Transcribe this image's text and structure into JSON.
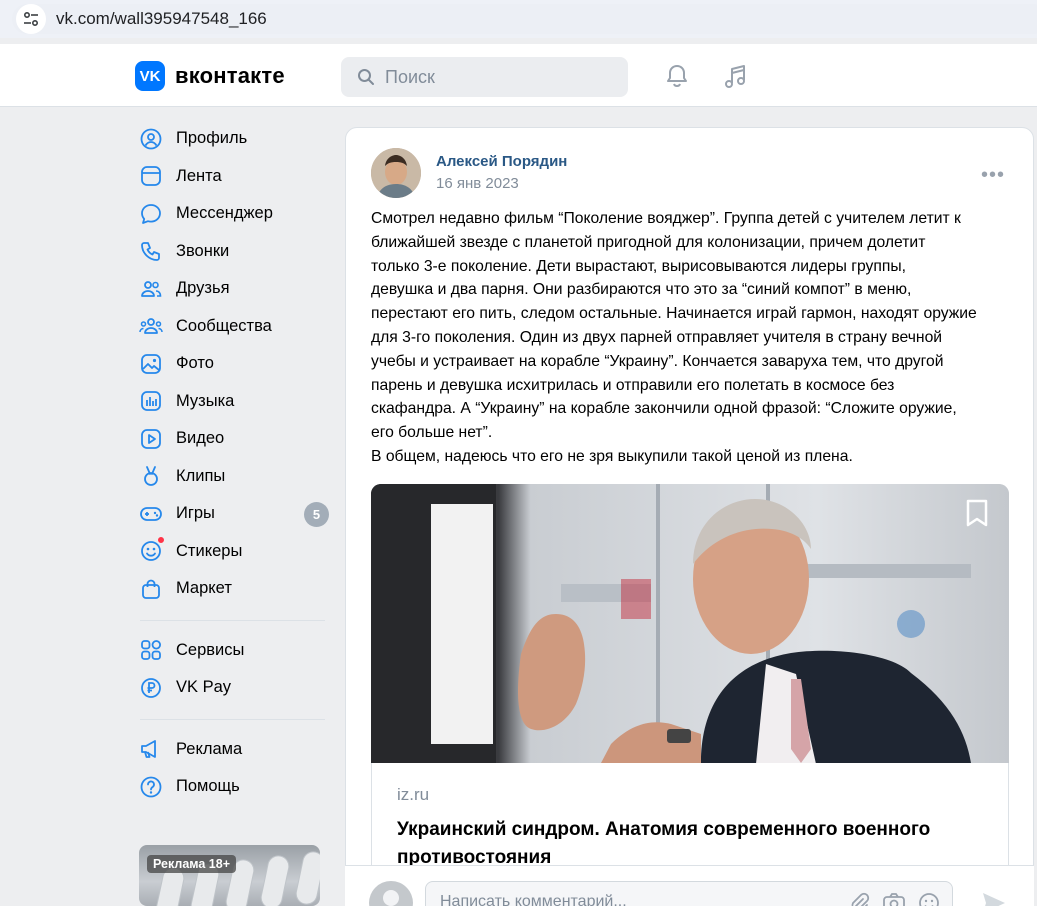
{
  "browser": {
    "url": "vk.com/wall395947548_166"
  },
  "header": {
    "logo_mark": "VK",
    "logo_text": "вконтакте",
    "search_placeholder": "Поиск"
  },
  "sidebar": {
    "items": [
      {
        "label": "Профиль",
        "icon": "profile-icon"
      },
      {
        "label": "Лента",
        "icon": "news-icon"
      },
      {
        "label": "Мессенджер",
        "icon": "messenger-icon"
      },
      {
        "label": "Звонки",
        "icon": "phone-icon"
      },
      {
        "label": "Друзья",
        "icon": "friends-icon"
      },
      {
        "label": "Сообщества",
        "icon": "communities-icon"
      },
      {
        "label": "Фото",
        "icon": "photo-icon"
      },
      {
        "label": "Музыка",
        "icon": "music-icon"
      },
      {
        "label": "Видео",
        "icon": "video-icon"
      },
      {
        "label": "Клипы",
        "icon": "clips-icon"
      },
      {
        "label": "Игры",
        "icon": "games-icon",
        "badge": "5"
      },
      {
        "label": "Стикеры",
        "icon": "stickers-icon"
      },
      {
        "label": "Маркет",
        "icon": "market-icon"
      }
    ],
    "group2": [
      {
        "label": "Сервисы",
        "icon": "services-icon"
      },
      {
        "label": "VK Pay",
        "icon": "vkpay-icon"
      }
    ],
    "group3": [
      {
        "label": "Реклама",
        "icon": "ads-icon"
      },
      {
        "label": "Помощь",
        "icon": "help-icon"
      }
    ],
    "ad_label": "Реклама 18+"
  },
  "post": {
    "author": "Алексей Порядин",
    "date": "16 янв 2023",
    "more": "•••",
    "text_lines": [
      "Смотрел недавно фильм “Поколение вояджер”. Группа детей с учителем летит к",
      "ближайшей звезде с планетой пригодной для колонизации, причем долетит",
      "только 3-е поколение. Дети вырастают, вырисовываются лидеры группы,",
      "девушка и два парня. Они разбираются что это за “синий компот” в меню,",
      "перестают его пить, следом остальные. Начинается играй гармон, находят оружие",
      "для 3-го поколения. Один из двух парней отправляет учителя в страну вечной",
      "учебы и устраивает на корабле “Украину”. Кончается заваруха тем, что другой",
      "парень и девушка исхитрилась и отправили его полетать в космосе без",
      "скафандра. А “Украину” на корабле закончили одной фразой: “Сложите оружие,",
      "его больше нет”.",
      "В общем, надеюсь что его не зря выкупили такой ценой из плена."
    ],
    "link": {
      "domain": "iz.ru",
      "title": "Украинский синдром. Анатомия современного военного противостояния"
    }
  },
  "comment": {
    "placeholder": "Написать комментарий..."
  }
}
